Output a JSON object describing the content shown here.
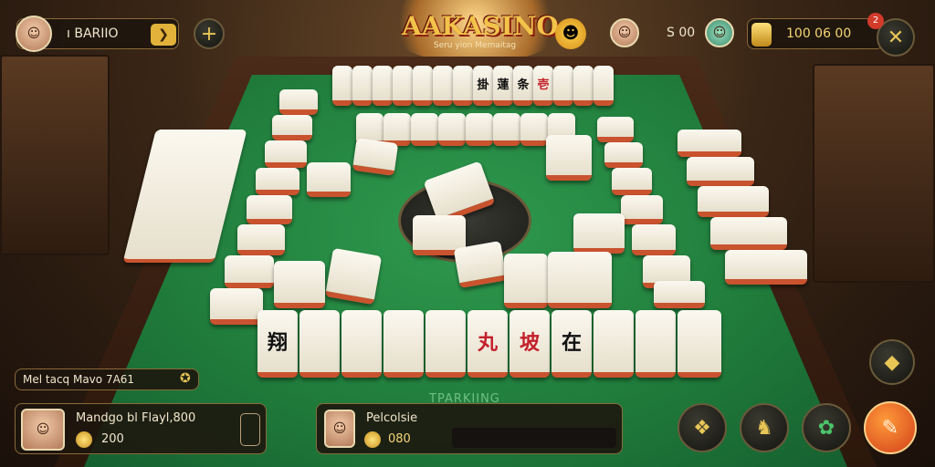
{
  "header": {
    "player_name": "ı BARIIO",
    "logo_title": "AAKASINO",
    "logo_subtitle": "Seru yion Memaitag",
    "balance_small": "S 00",
    "balance_gold": "100 06 00",
    "notif_badge": "2"
  },
  "table": {
    "felt_label": "TPARKIING",
    "tiles_top": [
      "",
      "",
      "",
      "",
      "",
      "",
      "",
      "掛",
      "蓮",
      "条",
      "壱",
      "",
      "",
      ""
    ],
    "tiles_bottom": [
      "翔",
      "",
      "",
      "",
      "",
      "",
      "",
      "丸",
      "坡",
      "在",
      "",
      "",
      ""
    ]
  },
  "bottom_left": {
    "info_text": "Mel tacq Mavo 7A61",
    "player_label": "Mandgo bl Flayl,800",
    "coins": "200"
  },
  "bottom_center": {
    "player_label": "Pelcolsie",
    "coins": "080"
  },
  "colors": {
    "felt": "#1f7a3a",
    "tile_edge": "#c9532e",
    "accent": "#e8c656"
  }
}
